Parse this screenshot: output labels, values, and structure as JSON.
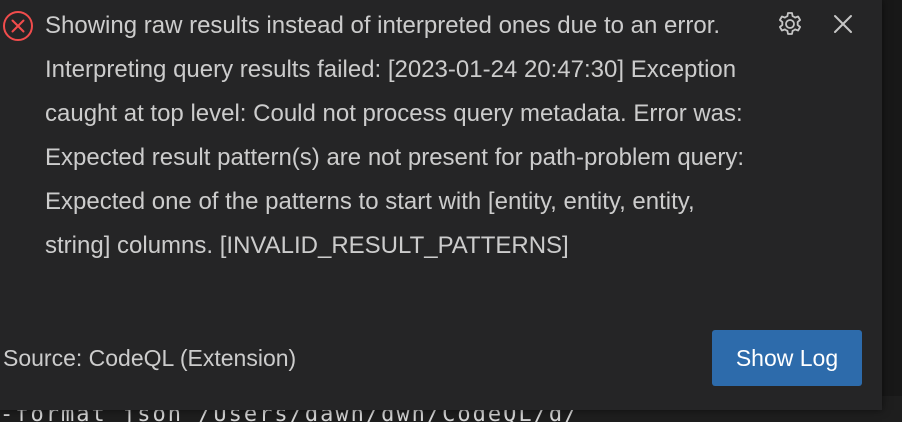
{
  "notification": {
    "message": "Showing raw results instead of interpreted ones due to an error. Interpreting query results failed: [2023-01-24 20:47:30] Exception caught at top level: Could not process query metadata. Error was: Expected result pattern(s) are not present for path-problem query: Expected one of the patterns to start with [entity, entity, entity, string] columns. [INVALID_RESULT_PATTERNS]",
    "source": "Source: CodeQL (Extension)",
    "action_label": "Show Log",
    "severity_icon": "error-circle-x-icon",
    "settings_icon": "gear-icon",
    "close_icon": "close-icon"
  },
  "terminal": {
    "visible_text": "-format json /Users/dawn/dwn/CodeQL/d/"
  },
  "colors": {
    "toast_background": "#252526",
    "error": "#f14c4c",
    "text": "#cccccc",
    "button": "#2d6bab",
    "button_text": "#ffffff"
  }
}
